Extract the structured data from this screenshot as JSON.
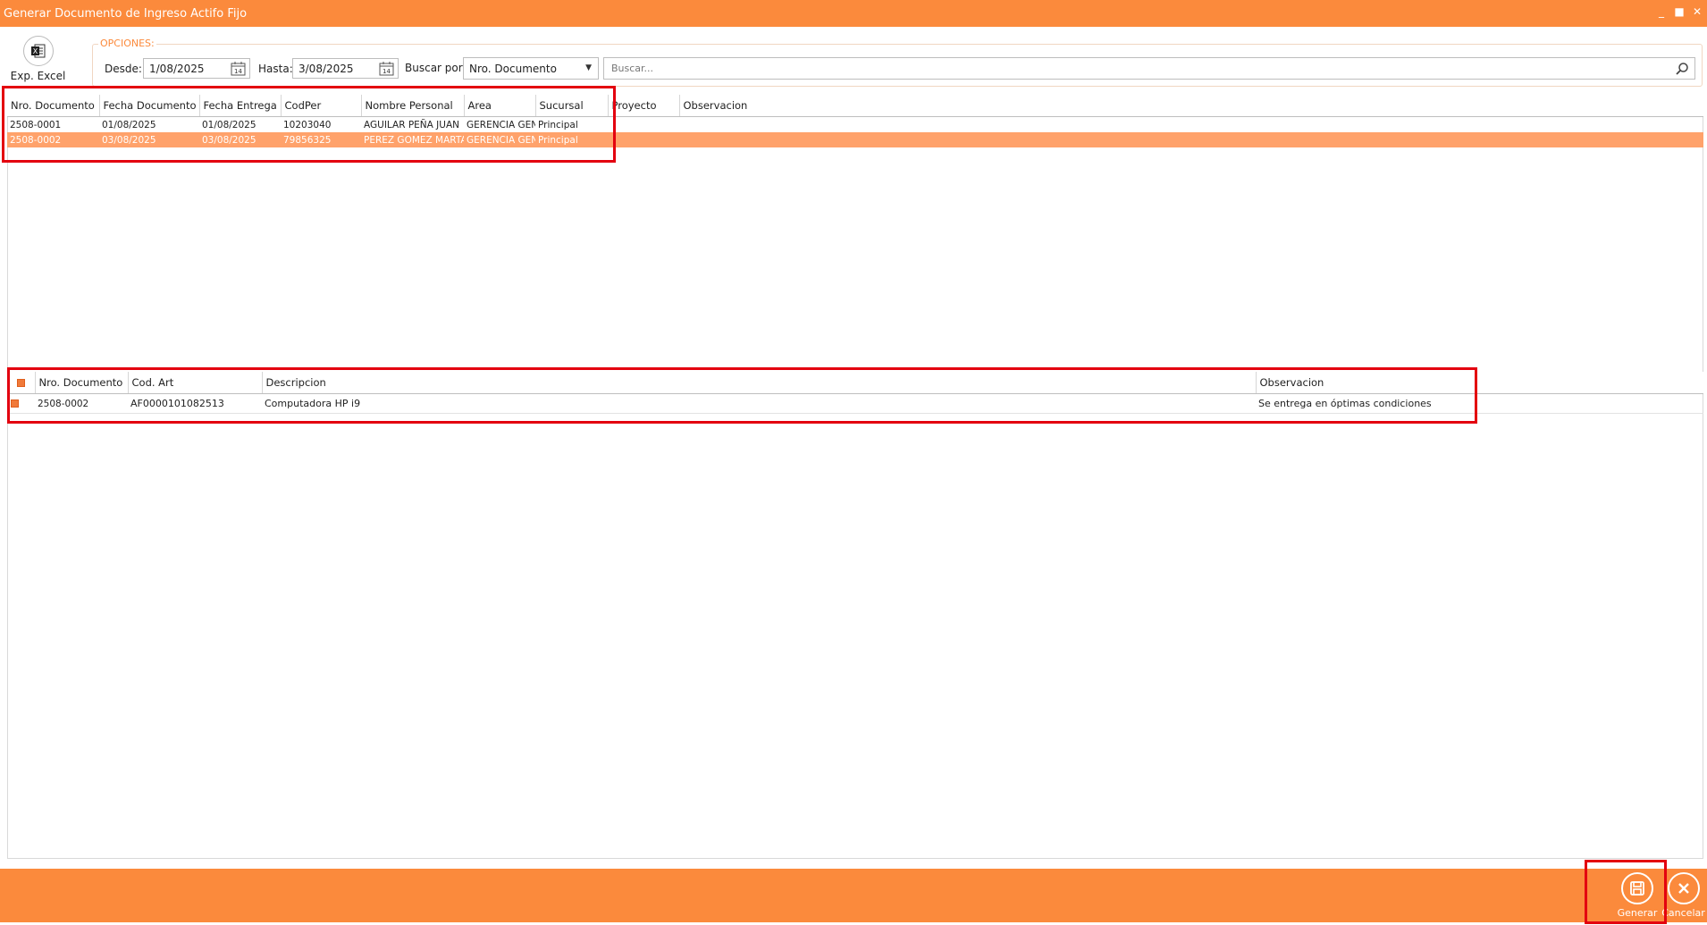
{
  "window": {
    "title": "Generar Documento de Ingreso Actifo Fijo",
    "controls": [
      "_",
      "■",
      "✕"
    ]
  },
  "toolbar": {
    "excel_label": "Exp. Excel",
    "excel_glyph": "X"
  },
  "options": {
    "legend": "OPCIONES:",
    "desde_label": "Desde:",
    "desde_value": "1/08/2025",
    "hasta_label": "Hasta:",
    "hasta_value": "3/08/2025",
    "calendar_day": "14",
    "buscar_por_label": "Buscar por:",
    "buscar_por_value": "Nro. Documento",
    "search_placeholder": "Buscar..."
  },
  "documents": {
    "columns": [
      "Nro. Documento",
      "Fecha Documento",
      "Fecha Entrega",
      "CodPer",
      "Nombre Personal",
      "Area",
      "Sucursal",
      "Proyecto",
      "Observacion"
    ],
    "rows": [
      [
        "2508-0001",
        "01/08/2025",
        "01/08/2025",
        "10203040",
        "AGUILAR PEÑA JUAN",
        "GERENCIA GEN",
        "Principal",
        "",
        ""
      ],
      [
        "2508-0002",
        "03/08/2025",
        "03/08/2025",
        "79856325",
        "PEREZ GOMEZ MARTA",
        "GERENCIA GEN",
        "Principal",
        "",
        ""
      ]
    ],
    "selected_row": 1
  },
  "details": {
    "columns": [
      "Nro. Documento",
      "Cod. Art",
      "Descripcion",
      "Observacion"
    ],
    "rows": [
      [
        "2508-0002",
        "AF0000101082513",
        "Computadora HP i9",
        "Se entrega en óptimas condiciones"
      ]
    ]
  },
  "footer": {
    "generar_label": "Generar",
    "cancelar_label": "Cancelar"
  },
  "colors": {
    "accent": "#FB8A3C",
    "selection": "#FFA26B",
    "highlight_box": "#E3000F"
  }
}
